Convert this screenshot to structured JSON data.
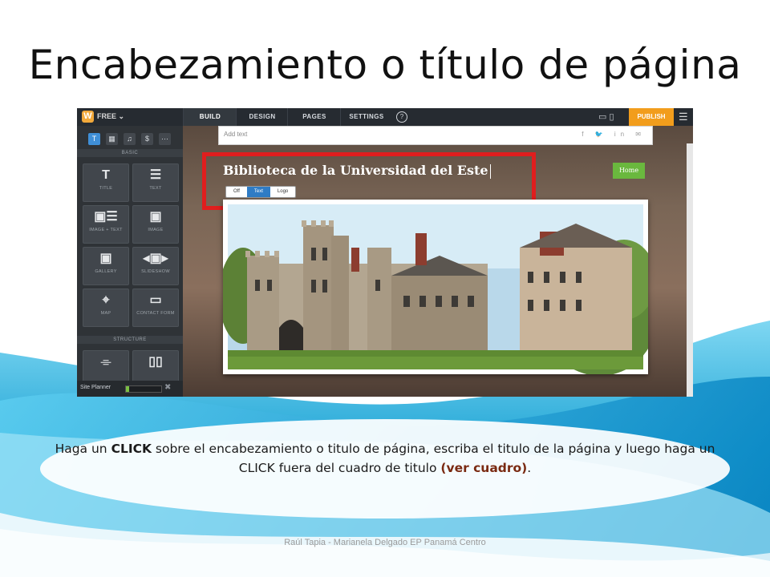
{
  "slide": {
    "title": "Encabezamiento o título de página",
    "caption_part1": "Haga un ",
    "caption_click": "CLICK",
    "caption_part2": " sobre el encabezamiento o titulo de página, escriba el titulo de la página y luego haga un CLICK fuera del cuadro de titulo ",
    "caption_highlight": "(ver cuadro)",
    "caption_end": ".",
    "footer": "Raúl Tapia - Marianela Delgado EP Panamá Centro"
  },
  "editor": {
    "logo": "W",
    "plan_label": "FREE ⌄",
    "tabs": [
      "BUILD",
      "DESIGN",
      "PAGES",
      "SETTINGS"
    ],
    "help": "?",
    "publish": "PUBLISH",
    "menu_icon": "☰",
    "devices": "▭ ▯",
    "tool_icons": [
      "T",
      "▦",
      "♫",
      "$",
      "···"
    ],
    "section_basic": "BASIC",
    "section_structure": "STRUCTURE",
    "elements": [
      {
        "icon": "T",
        "label": "TITLE"
      },
      {
        "icon": "☰",
        "label": "TEXT"
      },
      {
        "icon": "▣☰",
        "label": "IMAGE + TEXT"
      },
      {
        "icon": "▣",
        "label": "IMAGE"
      },
      {
        "icon": "▣",
        "label": "GALLERY"
      },
      {
        "icon": "◂▣▸",
        "label": "SLIDESHOW"
      },
      {
        "icon": "⌖",
        "label": "MAP"
      },
      {
        "icon": "▭",
        "label": "CONTACT FORM"
      },
      {
        "icon": "⌯",
        "label": ""
      },
      {
        "icon": "▯▯",
        "label": ""
      }
    ],
    "site_planner": "Site Planner",
    "site_planner_close": "✖",
    "site_planner_progress": 0.1,
    "add_text": "Add text",
    "social": "f 🐦 in ✉",
    "site_title": "Biblioteca de la Universidad del Este",
    "title_modes": [
      "Off",
      "Text",
      "Logo"
    ],
    "title_mode_active": "Text",
    "home_button": "Home"
  }
}
